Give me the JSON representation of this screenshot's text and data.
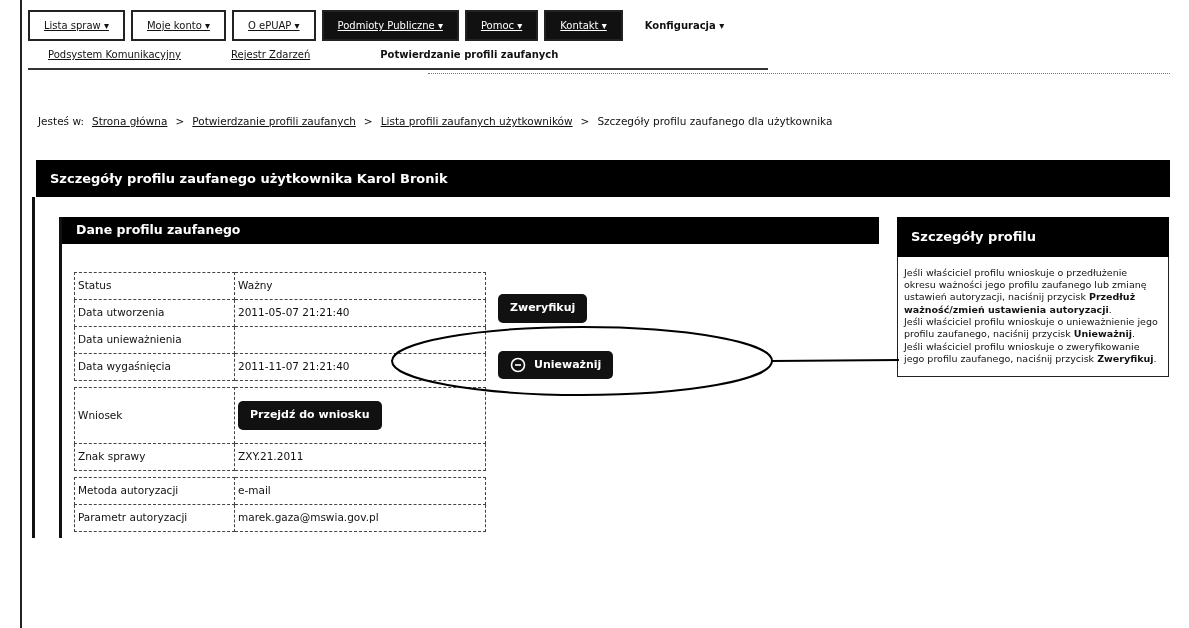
{
  "top_menu": [
    {
      "label": "Lista spraw",
      "caret": "▾",
      "kind": "boxed"
    },
    {
      "label": "Moje konto",
      "caret": "▾",
      "kind": "boxed"
    },
    {
      "label": "O ePUAP",
      "caret": "▾",
      "kind": "boxed"
    },
    {
      "label": "Podmioty Publiczne",
      "caret": "▾",
      "kind": "dark"
    },
    {
      "label": "Pomoc",
      "caret": "▾",
      "kind": "dark"
    },
    {
      "label": "Kontakt",
      "caret": "▾",
      "kind": "dark"
    },
    {
      "label": "Konfiguracja",
      "caret": "▾",
      "kind": "plain"
    }
  ],
  "sub_menu": [
    {
      "label": "Podsystem Komunikacyjny",
      "selected": false
    },
    {
      "label": "Rejestr Zdarzeń",
      "selected": false
    },
    {
      "label": "Potwierdzanie profili zaufanych",
      "selected": true
    }
  ],
  "breadcrumb": {
    "prefix": "Jesteś w:",
    "separator": ">",
    "items": [
      {
        "label": "Strona główna",
        "link": true
      },
      {
        "label": "Potwierdzanie profili zaufanych",
        "link": true
      },
      {
        "label": "Lista profili zaufanych użytkowników",
        "link": true
      },
      {
        "label": "Szczegóły profilu zaufanego dla użytkownika",
        "link": false
      }
    ]
  },
  "page_title": "Szczegóły profilu zaufanego użytkownika Karol Bronik",
  "panel": {
    "title": "Dane profilu zaufanego",
    "groups": [
      [
        {
          "label": "Status",
          "value": "Ważny",
          "kind": "text"
        },
        {
          "label": "Data utworzenia",
          "value": "2011-05-07 21:21:40",
          "kind": "text"
        },
        {
          "label": "Data unieważnienia",
          "kind": "empty"
        },
        {
          "label": "Data wygaśnięcia",
          "value": "2011-11-07 21:21:40",
          "kind": "text"
        }
      ],
      [
        {
          "label": "Wniosek",
          "value": "Przejdź do wniosku",
          "kind": "button"
        },
        {
          "label": "Znak sprawy",
          "value": "ZXY.21.2011",
          "kind": "text"
        }
      ],
      [
        {
          "label": "Metoda autoryzacji",
          "value": "e-mail",
          "kind": "text"
        },
        {
          "label": "Parametr autoryzacji",
          "value": "marek.gaza@mswia.gov.pl",
          "kind": "text"
        }
      ]
    ],
    "buttons": [
      {
        "label": "Zweryfikuj",
        "icon": false
      },
      {
        "label": "Unieważnij",
        "icon": true
      }
    ]
  },
  "side_box": {
    "title": "Szczegóły profilu",
    "paragraphs": [
      "Jeśli właściciel profilu wnioskuje o przedłużenie okresu ważności jego profilu zaufanego lub zmianę ustawień autoryzacji, naciśnij przycisk **Przedłuż ważność/zmień ustawienia autoryzacji**.",
      "Jeśli właściciel profilu wnioskuje o unieważnienie jego profilu zaufanego, naciśnij przycisk **Unieważnij**.",
      "Jeśli właściciel profilu wnioskuje o zweryfikowanie jego profilu zaufanego, naciśnij przycisk **Zweryfikuj**."
    ]
  }
}
